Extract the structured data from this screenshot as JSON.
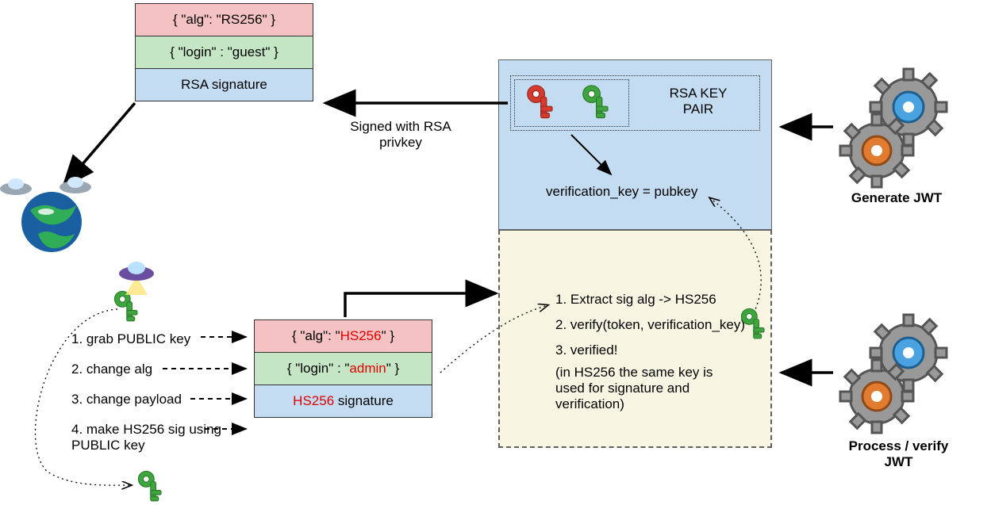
{
  "jwt1": {
    "header": "{ \"alg\": \"RS256\" }",
    "payload": "{ \"login\" : \"guest\" }",
    "sig": "RSA signature"
  },
  "jwt2": {
    "header_pre": "{ \"alg\": \"",
    "header_alg": "HS256",
    "header_post": "\" }",
    "payload_pre": "{ \"login\" : \"",
    "payload_val": "admin",
    "payload_post": "\" }",
    "sig_alg": "HS256",
    "sig_rest": " signature"
  },
  "signed_label": "Signed with RSA privkey",
  "keypair_label": "RSA KEY PAIR",
  "verif_key": "verification_key = pubkey",
  "gen_label": "Generate JWT",
  "proc_label": "Process / verify JWT",
  "attack": {
    "s1": "1. grab PUBLIC key",
    "s2": "2. change alg",
    "s3": "3. change payload",
    "s4": "4. make HS256 sig using PUBLIC key"
  },
  "verify": {
    "s1": "1. Extract sig alg -> HS256",
    "s2": "2. verify(token, verification_key)",
    "s3": "3. verified!",
    "s4": "(in HS256 the same key is used for signature and verification)"
  }
}
